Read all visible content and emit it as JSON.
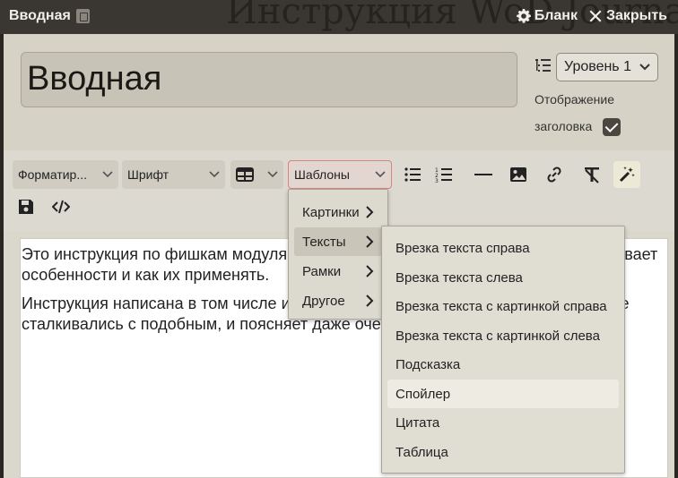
{
  "background_title": "Инструкция WoD Journal RU",
  "window": {
    "title": "Вводная",
    "blank_label": "Бланк",
    "close_label": "Закрыть"
  },
  "header": {
    "title_value": "Вводная",
    "level_selected": "Уровень 1",
    "show_title_label": "Отображение заголовка",
    "show_title_checked": true
  },
  "toolbar": {
    "format_label": "Форматир...",
    "font_label": "Шрифт",
    "templates_label": "Шаблоны",
    "icons": [
      "table-icon",
      "bullet-list-icon",
      "numbered-list-icon",
      "horizontal-rule-icon",
      "image-icon",
      "link-icon",
      "clear-format-icon",
      "magic-wand-icon",
      "save-icon",
      "code-icon"
    ]
  },
  "editor": {
    "paragraphs": [
      "Это инструкция по фишкам модуля, которая описывает его возможности, описывает особенности и как их применять.",
      "Инструкция написана в том числе и с расчетом на Фаундри и людей, которые не сталкивались с подобным, и поясняет даже очевидные вещи, надеюсь, пр..."
    ]
  },
  "templates_menu": {
    "items": [
      {
        "label": "Картинки",
        "submenu": true
      },
      {
        "label": "Тексты",
        "submenu": true,
        "selected": true
      },
      {
        "label": "Рамки",
        "submenu": true
      },
      {
        "label": "Другое",
        "submenu": true
      }
    ]
  },
  "texts_submenu": {
    "items": [
      {
        "label": "Врезка текста справа"
      },
      {
        "label": "Врезка текста слева"
      },
      {
        "label": "Врезка текста с картинкой справа"
      },
      {
        "label": "Врезка текста с картинкой слева"
      },
      {
        "label": "Подсказка"
      },
      {
        "label": "Спойлер",
        "hovered": true
      },
      {
        "label": "Цитата"
      },
      {
        "label": "Таблица"
      }
    ]
  },
  "colors": {
    "topbar": "#3a3631",
    "panel": "#d6d2c5",
    "accent_border": "#d98480"
  }
}
